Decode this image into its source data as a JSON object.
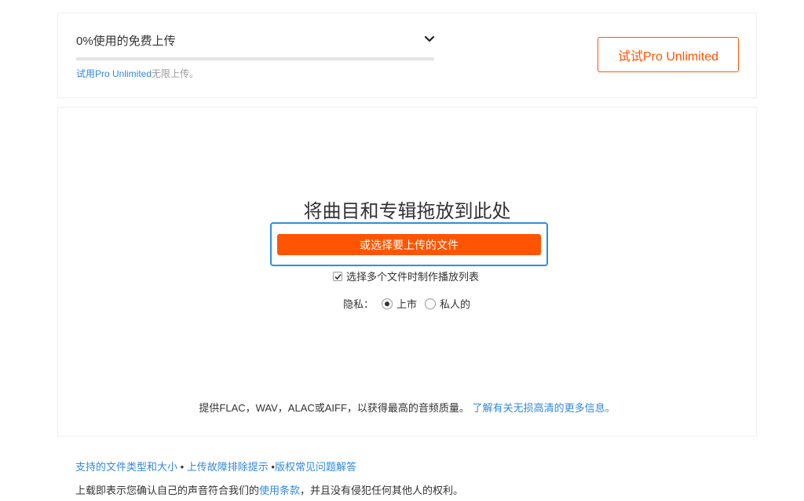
{
  "quota": {
    "title": "0%使用的免费上传",
    "percent_used": 0,
    "note_link": "试用Pro Unlimited",
    "note_suffix": "无限上传。",
    "try_pro_label": "试试Pro Unlimited"
  },
  "upload": {
    "drop_title": "将曲目和专辑拖放到此处",
    "choose_label": "或选择要上传的文件",
    "playlist_label": "选择多个文件时制作播放列表",
    "playlist_checked": true,
    "privacy_label": "隐私：",
    "privacy_options": [
      {
        "label": "上市",
        "checked": true
      },
      {
        "label": "私人的",
        "checked": false
      }
    ],
    "quality_text": "提供FLAC，WAV，ALAC或AIFF，以获得最高的音频质量。",
    "quality_link": "了解有关无损高清的更多信息。"
  },
  "footer": {
    "link1": "支持的文件类型和大小",
    "sep1": " • ",
    "link2": "上传故障排除提示",
    "sep2": " •",
    "link3": "版权常见问题解答",
    "legal_prefix": "上载即表示您确认自己的声音符合我们的",
    "legal_link": "使用条款",
    "legal_suffix": "，并且没有侵犯任何其他人的权利。"
  },
  "colors": {
    "accent": "#ff5500",
    "link": "#3388dd",
    "focus_ring": "#2f8fdc"
  }
}
